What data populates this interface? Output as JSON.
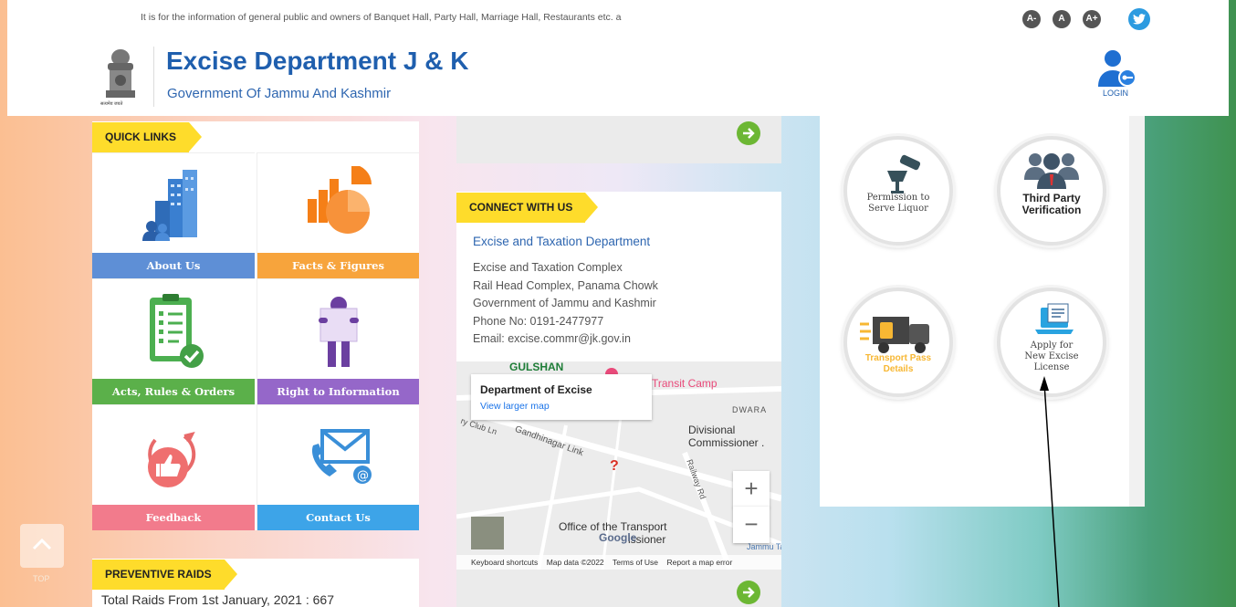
{
  "ticker": "It is for the information of general public and owners of Banquet Hall, Party Hall, Marriage Hall, Restaurants etc. a",
  "accessibility": [
    "A-",
    "A",
    "A+"
  ],
  "header": {
    "title": "Excise Department J & K",
    "subtitle": "Government Of Jammu And Kashmir",
    "emblem_caption": "सत्यमेव जयते",
    "login": "LOGIN"
  },
  "quick_links": {
    "heading": "QUICK LINKS",
    "tiles": [
      {
        "label": "About Us",
        "color": "#5e8fd6"
      },
      {
        "label": "Facts & Figures",
        "color": "#f7a43c"
      },
      {
        "label": "Acts, Rules & Orders",
        "color": "#5bb04a"
      },
      {
        "label": "Right to Information",
        "color": "#9567c9"
      },
      {
        "label": "Feedback",
        "color": "#f27b8c"
      },
      {
        "label": "Contact Us",
        "color": "#3da4e8"
      }
    ]
  },
  "connect": {
    "heading": "CONNECT WITH US",
    "org": "Excise and Taxation Department",
    "lines": [
      "Excise and Taxation Complex",
      "Rail Head Complex, Panama Chowk",
      "Government of Jammu and Kashmir",
      "Phone No: 0191-2477977",
      "Email: excise.commr@jk.gov.in"
    ]
  },
  "map": {
    "place": "Department of Excise",
    "larger": "View larger map",
    "labels": {
      "gulshan": "GULSHAN",
      "transit": "Transit Camp",
      "dwara": "DWARA",
      "club": "ry Club Ln",
      "link": "Gandhinagar Link",
      "divisional": "Divisional",
      "commissioner": "Commissioner .",
      "railway": "Railway Rd",
      "office": "Office of the Transport",
      "issioner": "issioner",
      "jammu": "Jammu Ta"
    },
    "footer": [
      "Keyboard shortcuts",
      "Map data ©2022",
      "Terms of Use",
      "Report a map error"
    ],
    "google": "Google"
  },
  "services": [
    {
      "label": "Permission to Serve Liquor"
    },
    {
      "label": "Third Party Verification"
    },
    {
      "label": "Transport Pass Details"
    },
    {
      "label": "Apply for New Excise License"
    }
  ],
  "raids": {
    "heading": "PREVENTIVE RAIDS",
    "text": "Total Raids From 1st January, 2021 : 667"
  },
  "totop": "TOP"
}
